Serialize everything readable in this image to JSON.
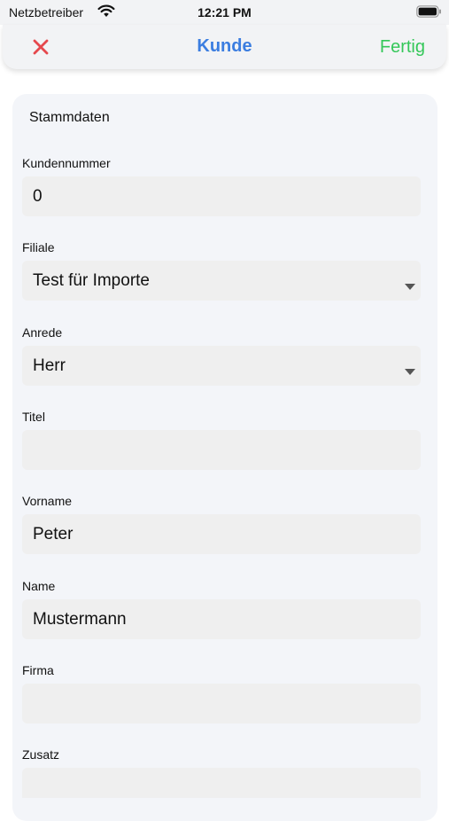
{
  "status_bar": {
    "carrier": "Netzbetreiber",
    "time": "12:21 PM",
    "icons": [
      "wifi-icon",
      "battery-icon"
    ]
  },
  "nav": {
    "close_icon": "close-icon",
    "title": "Kunde",
    "done_label": "Fertig",
    "colors": {
      "title": "#3b7de0",
      "done": "#34c759",
      "close": "#e5484d"
    }
  },
  "form": {
    "section_title": "Stammdaten",
    "fields": [
      {
        "label": "Kundennummer",
        "value": "0",
        "type": "text"
      },
      {
        "label": "Filiale",
        "value": "Test für Importe",
        "type": "select"
      },
      {
        "label": "Anrede",
        "value": "Herr",
        "type": "select"
      },
      {
        "label": "Titel",
        "value": "",
        "type": "text"
      },
      {
        "label": "Vorname",
        "value": "Peter",
        "type": "text"
      },
      {
        "label": "Name",
        "value": "Mustermann",
        "type": "text"
      },
      {
        "label": "Firma",
        "value": "",
        "type": "text"
      },
      {
        "label": "Zusatz",
        "value": "",
        "type": "text"
      }
    ]
  }
}
